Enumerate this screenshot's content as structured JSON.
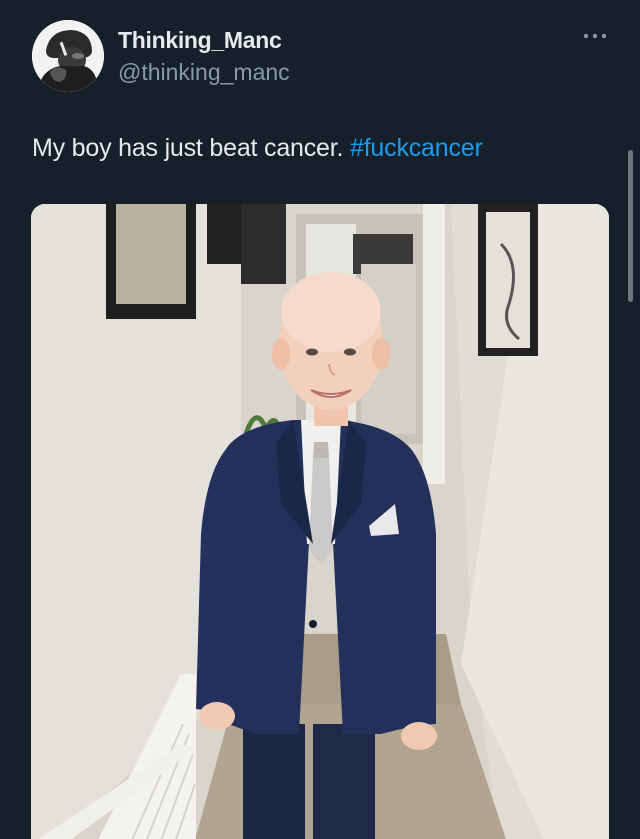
{
  "tweet": {
    "author": {
      "display_name": "Thinking_Manc",
      "handle": "@thinking_manc",
      "avatar_icon": "profile-photo"
    },
    "text_main": "My boy has just beat cancer. ",
    "hashtag": "#fuckcancer",
    "more_icon": "ellipsis-icon",
    "media": {
      "kind": "photo",
      "subject": "smiling bald boy in navy suit standing in hallway"
    }
  },
  "colors": {
    "background": "#15202b",
    "primary_text": "#e7e9ea",
    "secondary_text": "#8b98a5",
    "link": "#1d9bf0"
  }
}
